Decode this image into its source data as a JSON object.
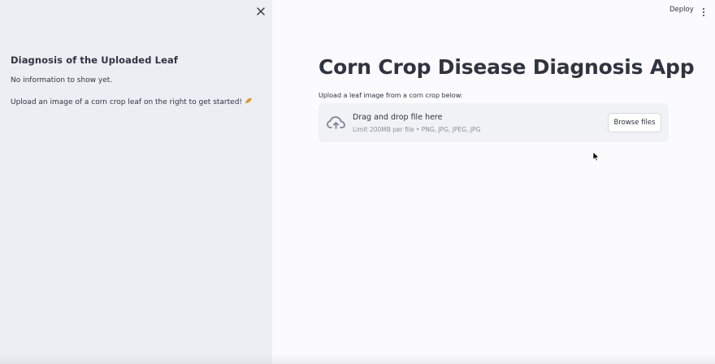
{
  "sidebar": {
    "close_icon": "close-icon",
    "heading": "Diagnosis of the Uploaded Leaf",
    "no_info": "No information to show yet.",
    "upload_hint": "Upload an image of a corn crop leaf on the right to get started!",
    "upload_hint_icon": "leaf-icon"
  },
  "header": {
    "deploy_label": "Deploy",
    "menu_icon": "more-vertical-icon"
  },
  "main": {
    "title": "Corn Crop Disease Diagnosis App",
    "uploader": {
      "label": "Upload a leaf image from a corn crop below:",
      "icon": "cloud-upload-icon",
      "drop_title": "Drag and drop file here",
      "limit_text": "Limit 200MB per file • PNG, JPG, JPEG, JPG",
      "browse_label": "Browse files"
    }
  },
  "colors": {
    "sidebar_bg": "#eceef3",
    "main_bg": "#fbfbfd",
    "dropzone_bg": "#f0f2f6",
    "text": "#31333f",
    "muted_text": "#8c8f99"
  }
}
